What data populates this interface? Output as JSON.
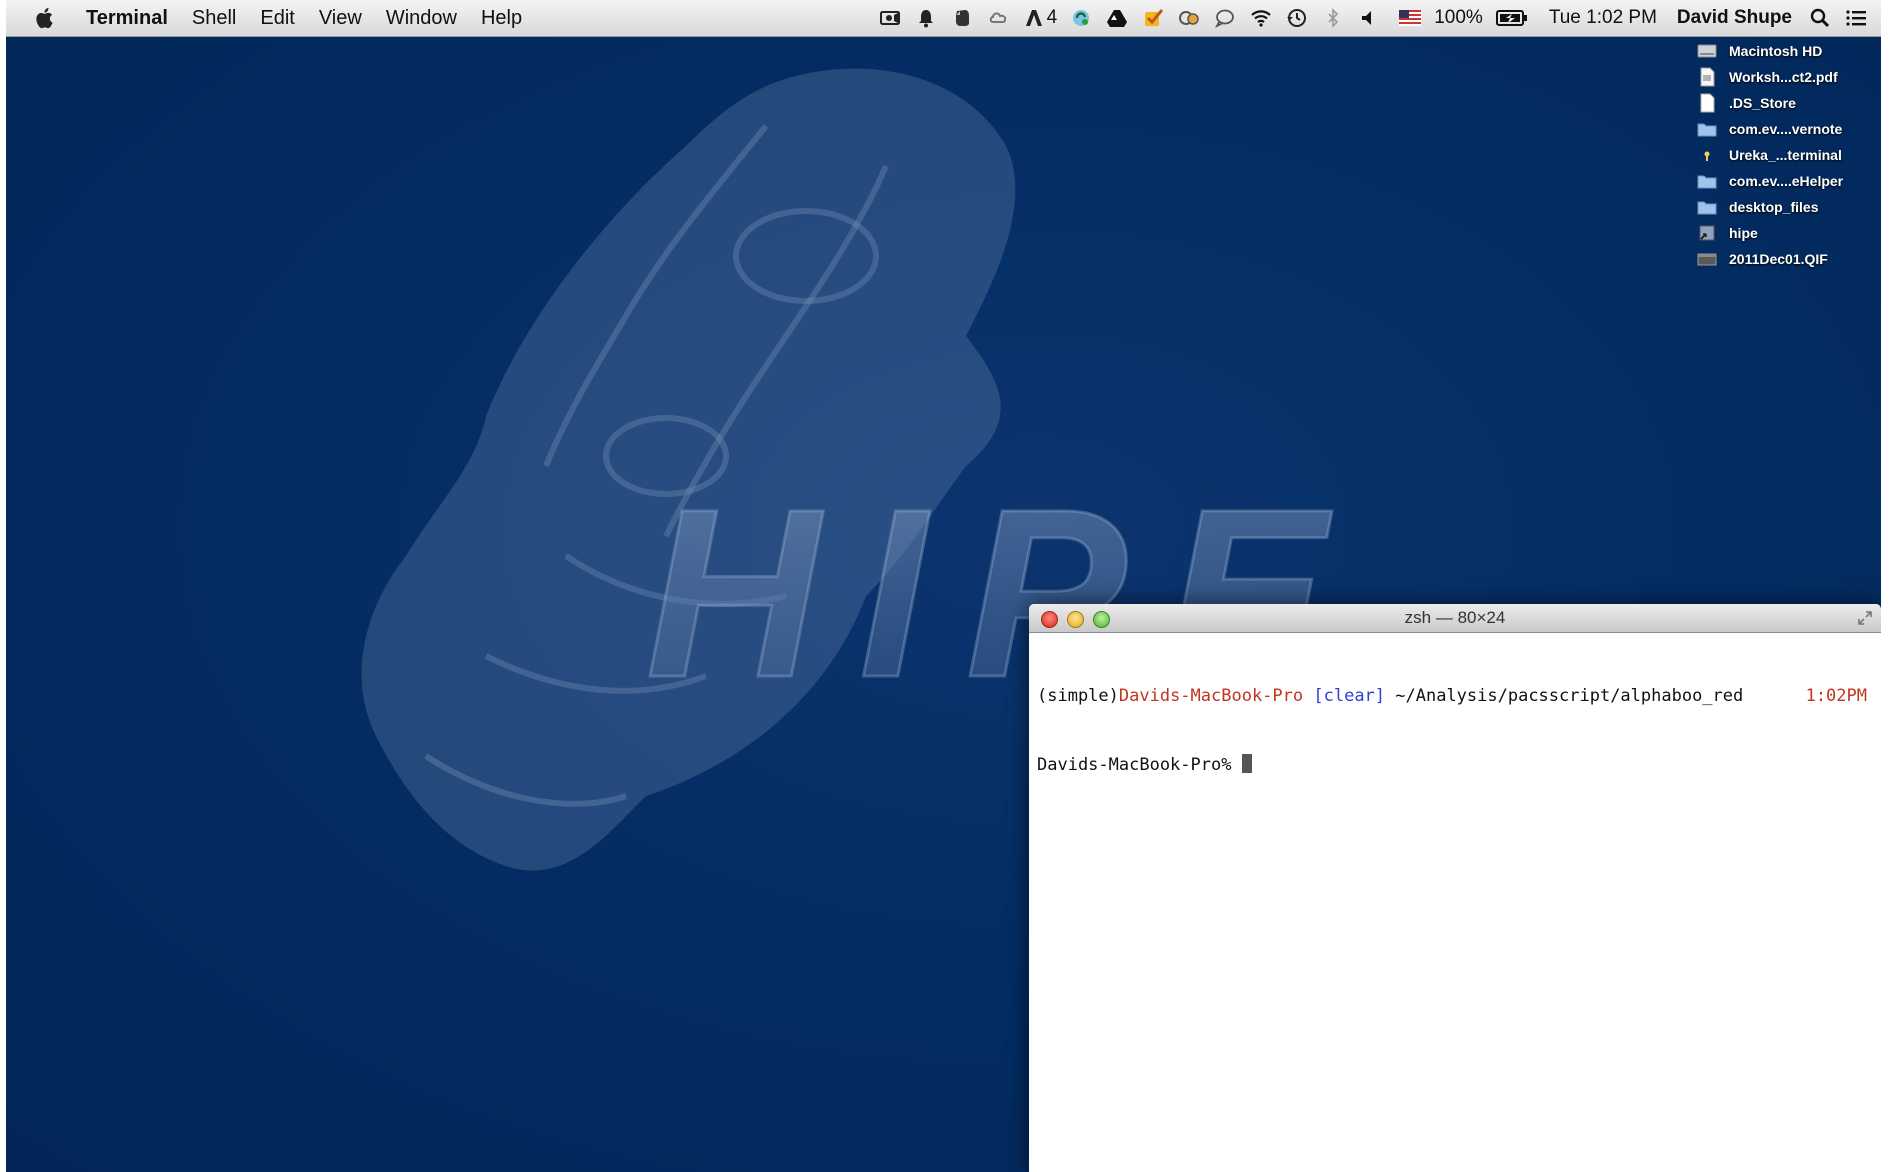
{
  "menubar": {
    "app_name": "Terminal",
    "items": [
      "Shell",
      "Edit",
      "View",
      "Window",
      "Help"
    ],
    "status": {
      "adobe_count": "4",
      "battery": "100%",
      "clock": "Tue 1:02 PM",
      "user": "David Shupe"
    }
  },
  "desktop": {
    "items": [
      {
        "label": "Macintosh HD",
        "icon": "hard-drive-icon"
      },
      {
        "label": "Worksh...ct2.pdf",
        "icon": "pdf-file-icon"
      },
      {
        "label": ".DS_Store",
        "icon": "document-icon"
      },
      {
        "label": "com.ev....vernote",
        "icon": "folder-icon"
      },
      {
        "label": "Ureka_...terminal",
        "icon": "terminal-file-icon"
      },
      {
        "label": "com.ev....eHelper",
        "icon": "folder-icon"
      },
      {
        "label": "desktop_files",
        "icon": "folder-icon"
      },
      {
        "label": "hipe",
        "icon": "alias-icon"
      },
      {
        "label": "2011Dec01.QIF",
        "icon": "qif-file-icon"
      }
    ]
  },
  "wallpaper": {
    "text": "HIPE"
  },
  "terminal": {
    "title": "zsh — 80×24",
    "prompt_env": "(simple)",
    "prompt_host": "Davids-MacBook-Pro",
    "prompt_tag": "[clear]",
    "prompt_path": " ~/Analysis/pacsscript/alphaboo_red",
    "prompt_time": "1:02PM",
    "prompt_line2": "Davids-MacBook-Pro% "
  },
  "colors": {
    "desktop_bg": "#032d63",
    "prompt_red": "#c23621",
    "prompt_blue": "#2f3fd0"
  }
}
